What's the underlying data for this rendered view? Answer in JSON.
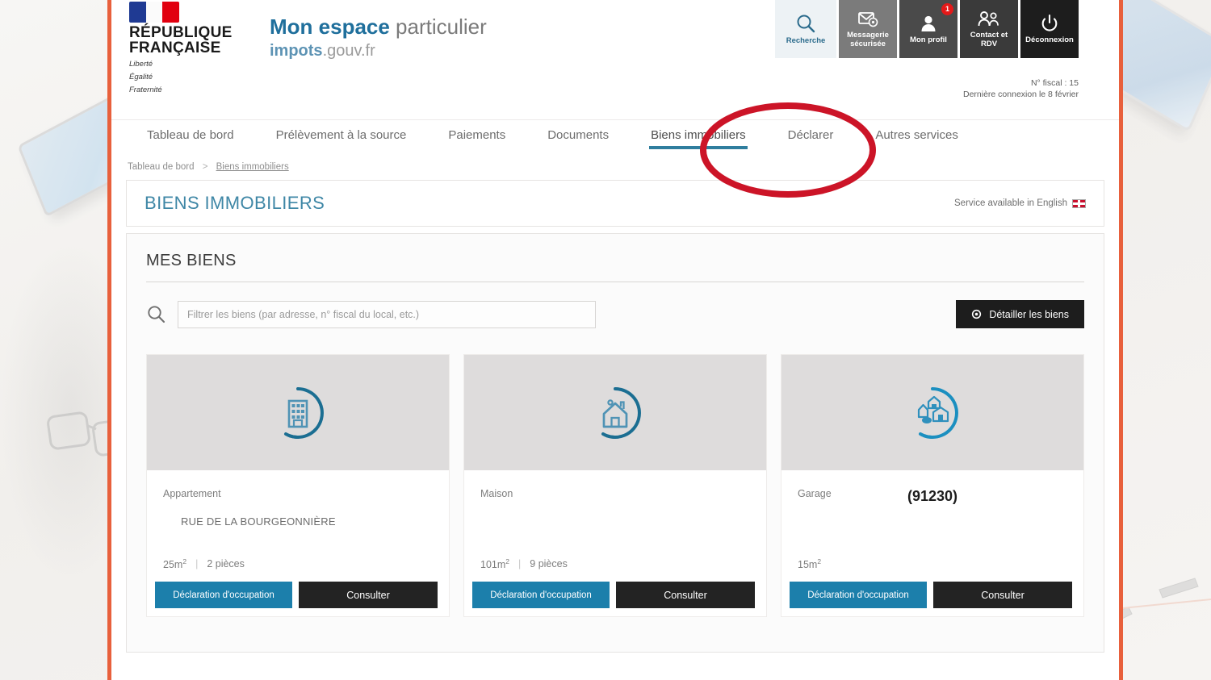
{
  "header": {
    "republic_line1": "RÉPUBLIQUE",
    "republic_line2": "FRANÇAISE",
    "motto_1": "Liberté",
    "motto_2": "Égalité",
    "motto_3": "Fraternité",
    "site_title_strong": "Mon espace",
    "site_title_rest": " particulier",
    "site_url_strong": "impots",
    "site_url_rest": ".gouv.fr",
    "actions": [
      {
        "label": "Recherche",
        "icon": "search-icon",
        "badge": ""
      },
      {
        "label": "Messagerie sécurisée",
        "icon": "mail-gear-icon",
        "badge": ""
      },
      {
        "label": "Mon profil",
        "icon": "user-icon",
        "badge": "1"
      },
      {
        "label": "Contact et RDV",
        "icon": "contacts-icon",
        "badge": ""
      },
      {
        "label": "Déconnexion",
        "icon": "power-icon",
        "badge": ""
      }
    ],
    "fiscal_number": "N° fiscal : 15",
    "last_connection": "Dernière connexion le 8 février"
  },
  "nav": {
    "items": [
      {
        "label": "Tableau de bord",
        "active": false
      },
      {
        "label": "Prélèvement à la source",
        "active": false
      },
      {
        "label": "Paiements",
        "active": false
      },
      {
        "label": "Documents",
        "active": false
      },
      {
        "label": "Biens immobiliers",
        "active": true
      },
      {
        "label": "Déclarer",
        "active": false
      },
      {
        "label": "Autres services",
        "active": false
      }
    ],
    "active_color": "#2f7e9e"
  },
  "breadcrumb": {
    "root": "Tableau de bord",
    "separator": ">",
    "current": "Biens immobiliers"
  },
  "panel": {
    "title": "BIENS IMMOBILIERS",
    "english_link": "Service available in English",
    "section_title": "MES BIENS"
  },
  "toolbar": {
    "search_placeholder": "Filtrer les biens (par adresse, n° fiscal du local, etc.)",
    "search_value": "",
    "search_icon": "magnifier-icon",
    "detail_button": "Détailler les biens",
    "detail_button_icon": "gear-icon"
  },
  "cards": [
    {
      "icon": "apartment-building-icon",
      "type": "Appartement",
      "address": "RUE DE LA BOURGEONNIÈRE",
      "zip": "",
      "surface": "25m",
      "surface_exp": "2",
      "rooms": "2 pièces",
      "divider": "|",
      "btn_declaration": "Déclaration d'occupation",
      "btn_consult": "Consulter"
    },
    {
      "icon": "house-icon",
      "type": "Maison",
      "address": "",
      "zip": "",
      "surface": "101m",
      "surface_exp": "2",
      "rooms": "9 pièces",
      "divider": "|",
      "btn_declaration": "Déclaration d'occupation",
      "btn_consult": "Consulter"
    },
    {
      "icon": "dependency-garage-icon",
      "type": "Garage",
      "address": "",
      "zip": "(91230)",
      "surface": "15m",
      "surface_exp": "2",
      "rooms": "",
      "divider": "",
      "btn_declaration": "Déclaration d'occupation",
      "btn_consult": "Consulter"
    }
  ],
  "annotation": {
    "shape": "red-ellipse-highlight",
    "target": "Biens immobiliers",
    "color": "#cc1427"
  },
  "colors": {
    "accent_teal": "#2f7e9e",
    "brand_blue": "#1c7fab",
    "dark_button": "#232323",
    "frame_border_orange": "#e8603c",
    "badge_red": "#e31919"
  }
}
